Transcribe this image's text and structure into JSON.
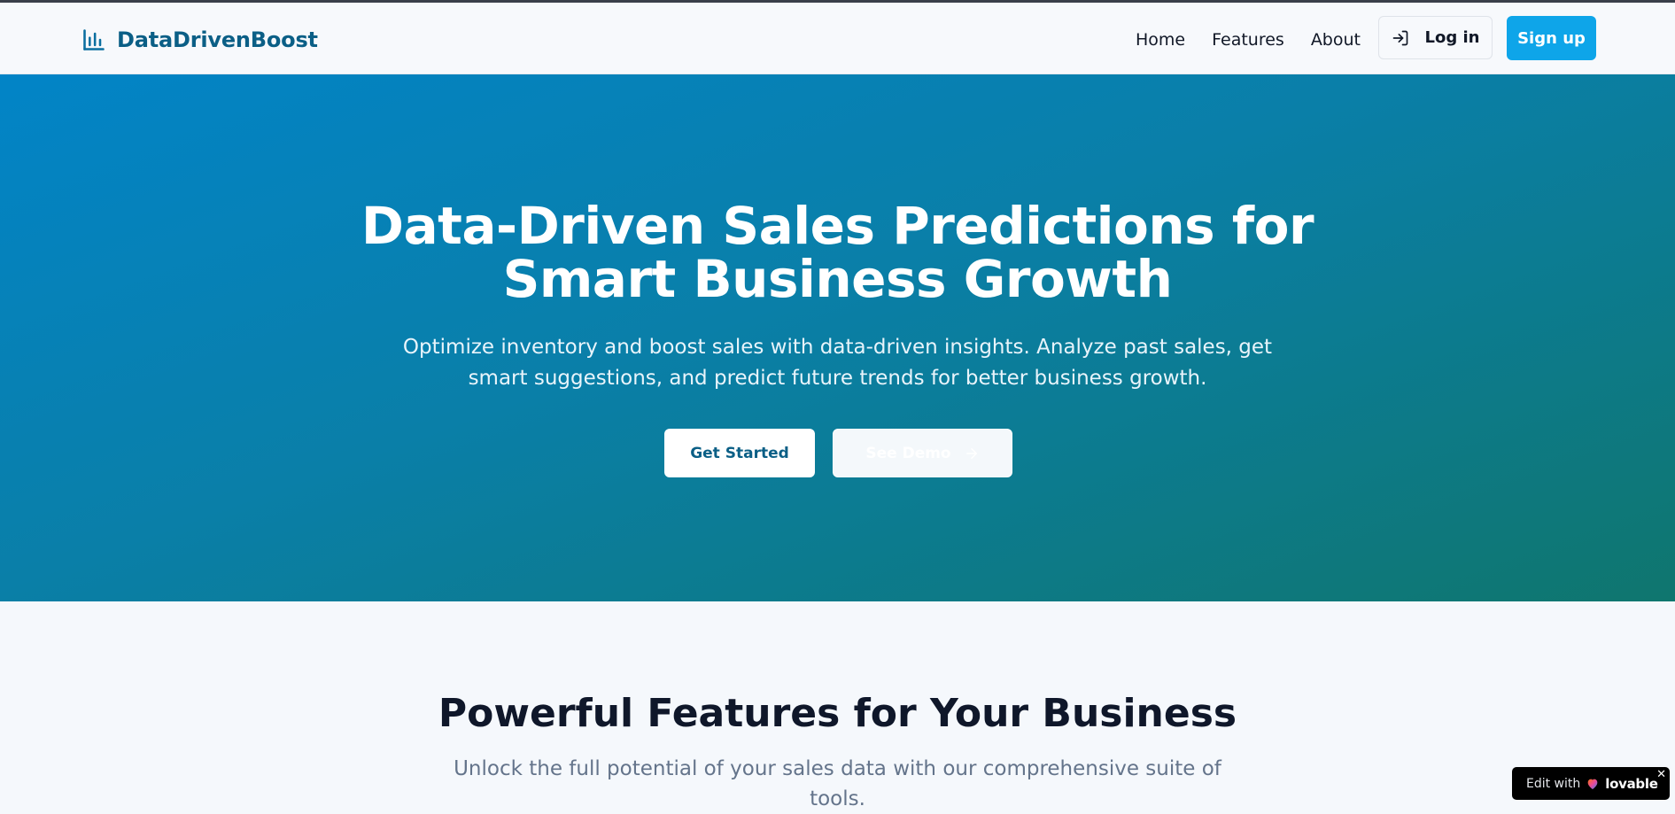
{
  "navbar": {
    "brand_name": "DataDrivenBoost",
    "brand_icon": "bar-chart-icon",
    "links": [
      "Home",
      "Features",
      "About"
    ],
    "login_label": "Log in",
    "login_icon": "log-in-icon",
    "signup_label": "Sign up"
  },
  "hero": {
    "title_lines": [
      "Data-Driven Sales Predictions for",
      "Smart Business Growth"
    ],
    "subtitle_lines": [
      "Optimize inventory and boost sales with data-driven insights. Analyze past sales, get",
      "smart suggestions, and predict future trends for better business growth."
    ],
    "primary_button": "Get Started",
    "secondary_button": "See Demo",
    "secondary_button_icon": "arrow-right-icon"
  },
  "features": {
    "title": "Powerful Features for Your Business",
    "subtitle_lines": [
      "Unlock the full potential of your sales data with our comprehensive suite of",
      "tools."
    ]
  },
  "badge": {
    "edit_text": "Edit with",
    "brand": "lovable",
    "close": "✕"
  },
  "colors": {
    "brand": "#0b5f86",
    "signup": "#0ea5e9",
    "hero_start": "#0284c7",
    "hero_end": "#0f766e"
  }
}
